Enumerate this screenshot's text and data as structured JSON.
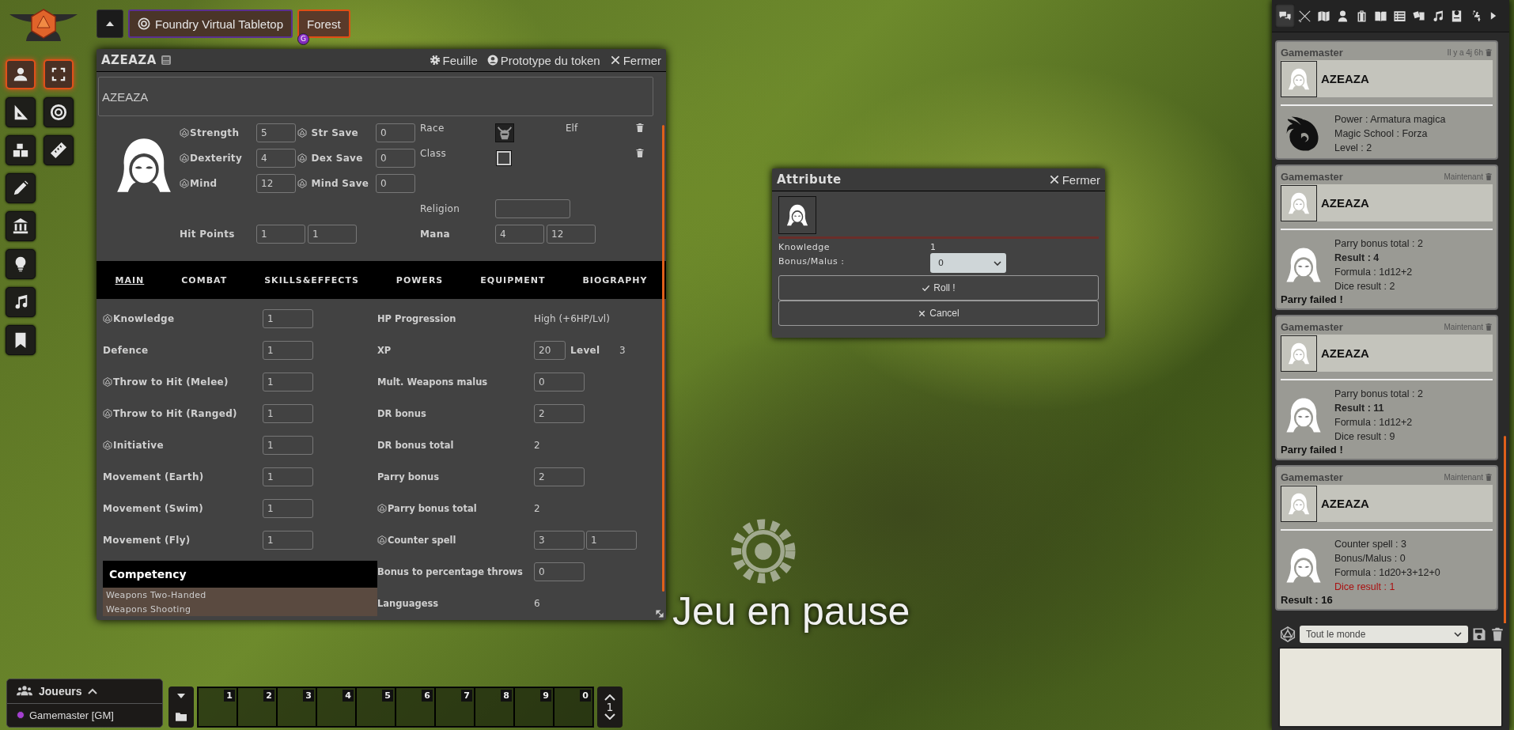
{
  "logo": {
    "kind": "anvil"
  },
  "scene_nav": {
    "scenes": [
      {
        "name": "Foundry Virtual Tabletop",
        "selected": false
      },
      {
        "name": "Forest",
        "selected": true,
        "badge": "G"
      }
    ]
  },
  "controls": {
    "layers": [
      {
        "selected": true
      },
      {
        "selected": false
      },
      {
        "selected": false
      },
      {
        "selected": false
      },
      {
        "selected": false
      },
      {
        "selected": false
      },
      {
        "selected": false
      },
      {
        "selected": false
      }
    ],
    "tools": [
      {
        "selected": true
      },
      {
        "selected": false
      },
      {
        "selected": false
      }
    ]
  },
  "sheet": {
    "title": "AZEAZA",
    "header_buttons": [
      {
        "kind": "sheet",
        "label": "Feuille"
      },
      {
        "kind": "token",
        "label": "Prototype du token"
      },
      {
        "kind": "close",
        "label": "Fermer"
      }
    ],
    "name": "AZEAZA",
    "attributes": [
      {
        "label": "Strength",
        "value": "5",
        "save_label": "Str Save",
        "save_value": "0",
        "rollable": true
      },
      {
        "label": "Dexterity",
        "value": "4",
        "save_label": "Dex Save",
        "save_value": "0",
        "rollable": true
      },
      {
        "label": "Mind",
        "value": "12",
        "save_label": "Mind Save",
        "save_value": "0",
        "rollable": true
      }
    ],
    "origins": [
      {
        "label": "Race",
        "has_image": true,
        "value": "Elf"
      },
      {
        "label": "Class",
        "has_image": false
      }
    ],
    "religion": {
      "label": "Religion"
    },
    "hit_points": {
      "label": "Hit Points",
      "values": [
        "1",
        "1"
      ]
    },
    "mana": {
      "label": "Mana",
      "values": [
        "4",
        "12"
      ]
    },
    "tabs": [
      {
        "label": "MAIN",
        "selected": true
      },
      {
        "label": "COMBAT",
        "selected": false
      },
      {
        "label": "SKILLS&EFFECTS",
        "selected": false
      },
      {
        "label": "POWERS",
        "selected": false
      },
      {
        "label": "EQUIPMENT",
        "selected": false
      },
      {
        "label": "BIOGRAPHY",
        "selected": false
      }
    ],
    "left_fields": [
      {
        "label": "Knowledge",
        "value": "1",
        "rollable": true
      },
      {
        "label": "Defence",
        "value": "1",
        "rollable": false
      },
      {
        "label": "Throw to Hit (Melee)",
        "value": "1",
        "rollable": true
      },
      {
        "label": "Throw to Hit (Ranged)",
        "value": "1",
        "rollable": true
      },
      {
        "label": "Initiative",
        "value": "1",
        "rollable": true
      },
      {
        "label": "Movement (Earth)",
        "value": "1",
        "rollable": false
      },
      {
        "label": "Movement (Swim)",
        "value": "1",
        "rollable": false
      },
      {
        "label": "Movement (Fly)",
        "value": "1",
        "rollable": false
      }
    ],
    "right_fields": [
      {
        "kind": "text",
        "label": "HP Progression",
        "value": "High (+6HP/Lvl)",
        "rollable": false
      },
      {
        "kind": "xp",
        "label": "XP",
        "values": [
          "20"
        ],
        "extra_label": "Level",
        "extra_value": "3",
        "rollable": false
      },
      {
        "kind": "inputs",
        "label": "Mult. Weapons malus",
        "values": [
          "0"
        ],
        "rollable": false
      },
      {
        "kind": "inputs",
        "label": "DR bonus",
        "values": [
          "2"
        ],
        "rollable": false
      },
      {
        "kind": "text",
        "label": "DR bonus total",
        "value": "2",
        "rollable": false
      },
      {
        "kind": "inputs",
        "label": "Parry bonus",
        "values": [
          "2"
        ],
        "rollable": false
      },
      {
        "kind": "text",
        "label": "Parry bonus total",
        "value": "2",
        "rollable": true
      },
      {
        "kind": "inputs",
        "label": "Counter spell",
        "values": [
          "3",
          "1"
        ],
        "rollable": true
      },
      {
        "kind": "inputs",
        "label": "Bonus to percentage throws",
        "values": [
          "0"
        ],
        "rollable": false
      },
      {
        "kind": "text",
        "label": "Languagess",
        "value": "6",
        "rollable": false
      }
    ],
    "competency": {
      "title": "Competency",
      "items": [
        "Weapons Two-Handed",
        "Weapons Shooting"
      ]
    }
  },
  "dialog": {
    "title": "Attribute",
    "close": "Fermer",
    "attribute_label": "Knowledge",
    "attribute_value": "1",
    "modifier_label": "Bonus/Malus :",
    "modifier_value": "0",
    "buttons": [
      {
        "kind": "confirm",
        "label": "Roll !"
      },
      {
        "kind": "cancel",
        "label": "Cancel"
      }
    ]
  },
  "pause": {
    "text": "Jeu en pause"
  },
  "chat": {
    "tabs": [
      {
        "selected": true
      },
      {
        "selected": false
      },
      {
        "selected": false
      },
      {
        "selected": false
      },
      {
        "selected": false
      },
      {
        "selected": false
      },
      {
        "selected": false
      },
      {
        "selected": false
      },
      {
        "selected": false
      },
      {
        "selected": false
      },
      {
        "selected": false
      }
    ],
    "messages": [
      {
        "speaker": "Gamemaster",
        "time": "Il y a 4j 6h",
        "actor": "AZEAZA",
        "kind": "power",
        "lines": [
          {
            "text": "Power : Armatura magica",
            "kind": "plain"
          },
          {
            "text": "Magic School : Forza",
            "kind": "plain"
          },
          {
            "text": "Level : 2",
            "kind": "plain"
          }
        ]
      },
      {
        "speaker": "Gamemaster",
        "time": "Maintenant",
        "actor": "AZEAZA",
        "kind": "roll",
        "lines": [
          {
            "text": "Parry bonus total : 2",
            "kind": "plain"
          },
          {
            "text": "Result : 4",
            "kind": "strong"
          },
          {
            "text": "Formula : 1d12+2",
            "kind": "plain"
          },
          {
            "text": "Dice result : 2",
            "kind": "plain"
          }
        ],
        "footer": "Parry failed !"
      },
      {
        "speaker": "Gamemaster",
        "time": "Maintenant",
        "actor": "AZEAZA",
        "kind": "roll",
        "lines": [
          {
            "text": "Parry bonus total : 2",
            "kind": "plain"
          },
          {
            "text": "Result : 11",
            "kind": "strong"
          },
          {
            "text": "Formula : 1d12+2",
            "kind": "plain"
          },
          {
            "text": "Dice result : 9",
            "kind": "plain"
          }
        ],
        "footer": "Parry failed !"
      },
      {
        "speaker": "Gamemaster",
        "time": "Maintenant",
        "actor": "AZEAZA",
        "kind": "roll",
        "lines": [
          {
            "text": "Counter spell : 3",
            "kind": "plain"
          },
          {
            "text": "Bonus/Malus : 0",
            "kind": "plain"
          },
          {
            "text": "Formula : 1d20+3+12+0",
            "kind": "plain"
          },
          {
            "text": "Dice result : 1",
            "kind": "failure"
          }
        ],
        "footer": "Result : 16"
      }
    ],
    "roll_mode": "Tout le monde"
  },
  "players": {
    "title": "Joueurs",
    "expanded": true,
    "users": [
      {
        "name": "Gamemaster [GM]",
        "color": "#a53fd0"
      }
    ]
  },
  "hotbar": {
    "slots": [
      "1",
      "2",
      "3",
      "4",
      "5",
      "6",
      "7",
      "8",
      "9",
      "0"
    ],
    "page": "1"
  }
}
